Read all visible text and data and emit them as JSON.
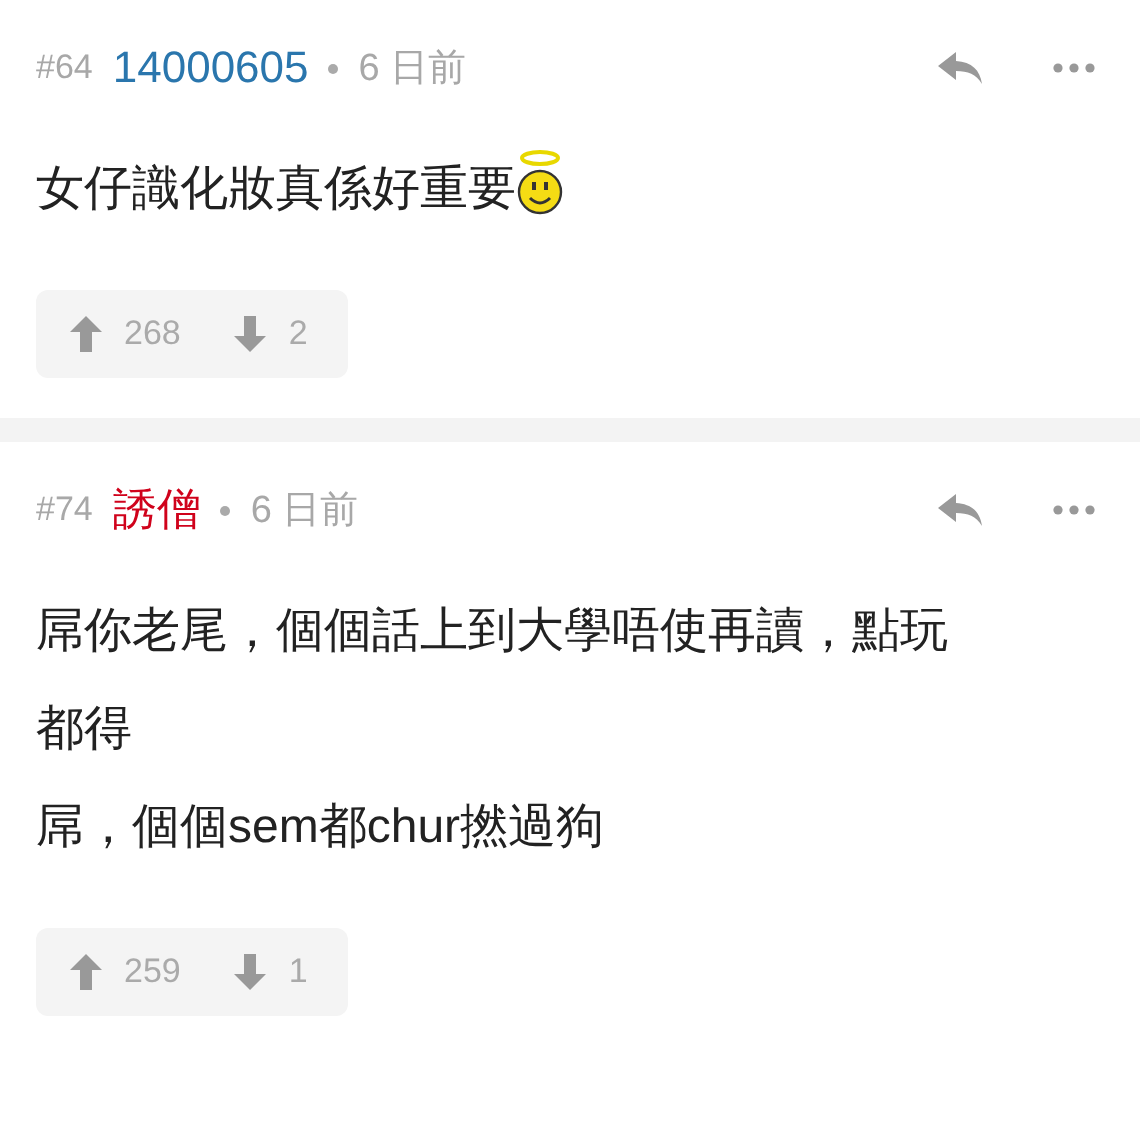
{
  "posts": [
    {
      "kind": "with-emoji",
      "number": "#64",
      "user": "14000605",
      "color": "#2a76ad",
      "time": "6 日前",
      "body": [
        "女仔識化妝真係好重要"
      ],
      "upvotes": "268",
      "downvotes": "2"
    },
    {
      "kind": "plain",
      "number": "#74",
      "user": "誘僧",
      "color": "#d0021b",
      "time": "6 日前",
      "body": [
        "屌你老尾，個個話上到大學唔使再讀，點玩",
        "都得",
        "屌，個個sem都chur撚過狗"
      ],
      "upvotes": "259",
      "downvotes": "1"
    }
  ]
}
